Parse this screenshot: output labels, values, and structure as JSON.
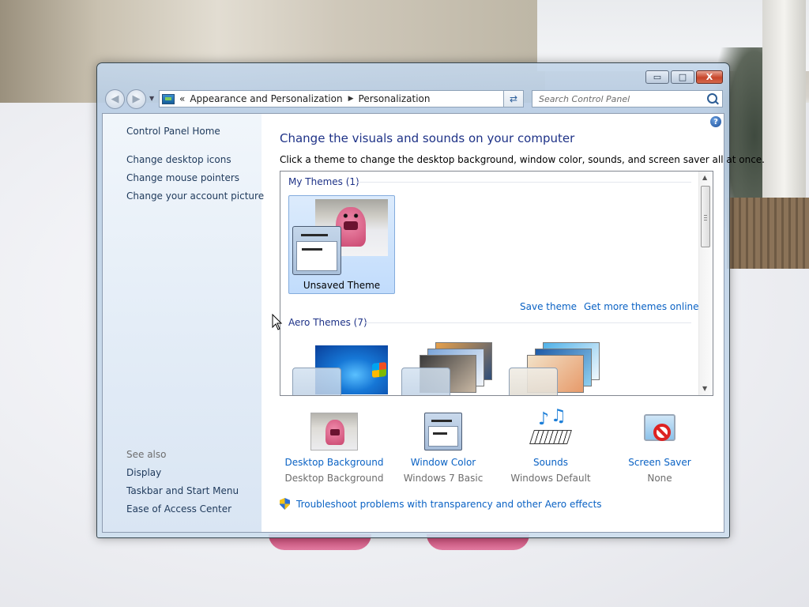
{
  "window": {
    "caption_buttons": {
      "minimize": "▭",
      "maximize": "□",
      "close": "X"
    }
  },
  "navbar": {
    "back_glyph": "◀",
    "forward_glyph": "▶",
    "address_prefix": "«",
    "breadcrumbs": [
      "Appearance and Personalization",
      "Personalization"
    ],
    "separator": "▶",
    "dropdown_glyph": "▼",
    "refresh_glyph": "⇄",
    "search_placeholder": "Search Control Panel"
  },
  "left_pane": {
    "home_link": "Control Panel Home",
    "tasks": [
      "Change desktop icons",
      "Change mouse pointers",
      "Change your account picture"
    ],
    "see_also_label": "See also",
    "see_also": [
      "Display",
      "Taskbar and Start Menu",
      "Ease of Access Center"
    ]
  },
  "content": {
    "help_glyph": "?",
    "title": "Change the visuals and sounds on your computer",
    "description": "Click a theme to change the desktop background, window color, sounds, and screen saver all at once.",
    "my_themes_label": "My Themes (1)",
    "selected_theme": "Unsaved Theme",
    "save_theme_link": "Save theme",
    "more_themes_link": "Get more themes online",
    "aero_themes_label": "Aero Themes (7)",
    "scroll_up": "▲",
    "scroll_down": "▼"
  },
  "settings": [
    {
      "label": "Desktop Background",
      "value": "Desktop Background",
      "icon": "desktop-background-icon"
    },
    {
      "label": "Window Color",
      "value": "Windows 7 Basic",
      "icon": "window-color-icon"
    },
    {
      "label": "Sounds",
      "value": "Windows Default",
      "icon": "sounds-icon"
    },
    {
      "label": "Screen Saver",
      "value": "None",
      "icon": "screen-saver-icon"
    }
  ],
  "troubleshoot_link": "Troubleshoot problems with transparency and other Aero effects",
  "colors": {
    "link": "#0a62c4",
    "heading": "#1e3287",
    "nav_link": "#1e395b",
    "selection_bg": "#c1dcfc"
  }
}
